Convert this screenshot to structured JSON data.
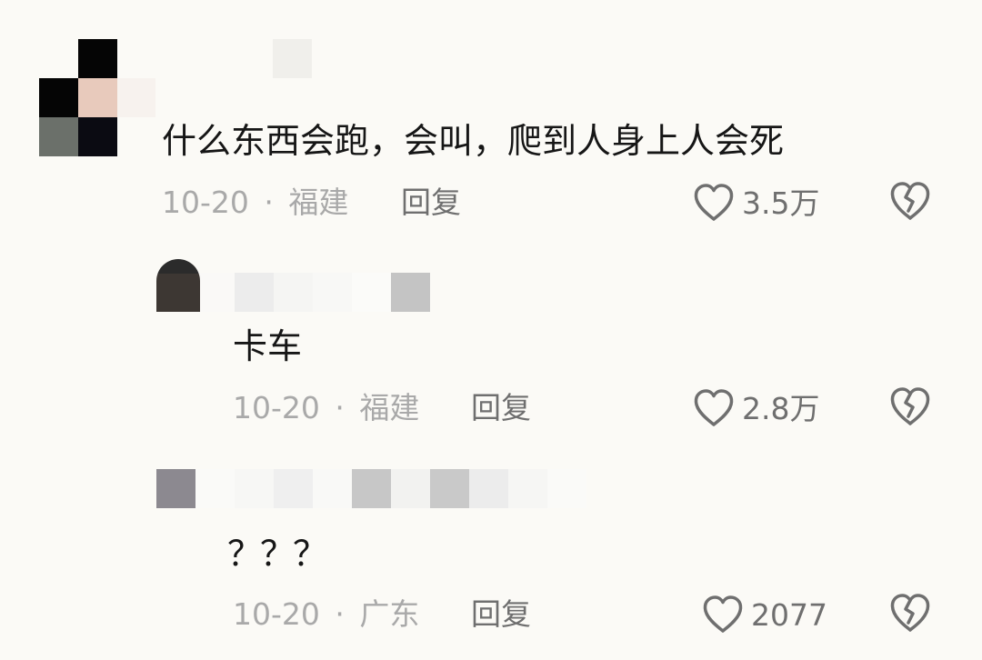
{
  "comments": [
    {
      "text": "什么东西会跑，会叫，爬到人身上人会死",
      "date": "10-20",
      "location": "福建",
      "reply_label": "回复",
      "likes": "3.5万"
    },
    {
      "text": "卡车",
      "date": "10-20",
      "location": "福建",
      "reply_label": "回复",
      "likes": "2.8万"
    },
    {
      "text": "？？？",
      "date": "10-20",
      "location": "广东",
      "reply_label": "回复",
      "likes": "2077"
    }
  ],
  "separator": "·",
  "icons": {
    "like": "heart-icon",
    "dislike": "broken-heart-icon"
  },
  "colors": {
    "background": "#fbfaf6",
    "text": "#161616",
    "meta": "#a9a9a9",
    "action": "#6f6f6f"
  }
}
